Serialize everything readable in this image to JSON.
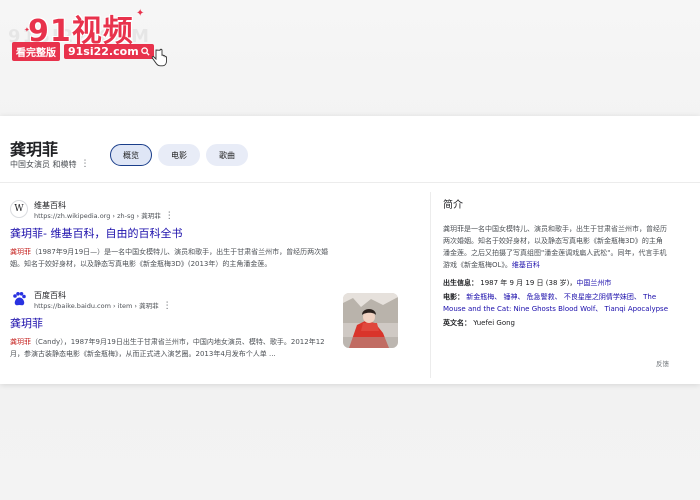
{
  "logo": {
    "brand": "91视频",
    "tag": "看完整版",
    "url": "91si22.com",
    "ghost": "91SI22.COM"
  },
  "entity": {
    "title": "龚玥菲",
    "subtitle": "中国女演员 和模特",
    "chips": [
      "概览",
      "电影",
      "歌曲"
    ]
  },
  "results": [
    {
      "source_name": "维基百科",
      "source_url": "https://zh.wikipedia.org › zh-sg › 龚玥菲",
      "title": "龚玥菲- 维基百科，自由的百科全书",
      "snippet_hl": "龚玥菲",
      "snippet": "（1987年9月19日—）是一名中国女模特儿、演员和歌手，出生于甘肃省兰州市，曾经历两次婚姻。知名于姣好身材，以及静态写真电影《新金瓶梅3D》(2013年）的主角潘金莲。"
    },
    {
      "source_name": "百度百科",
      "source_url": "https://baike.baidu.com › item › 龚玥菲",
      "title": "龚玥菲",
      "snippet_hl": "龚玥菲",
      "snippet": "（Candy），1987年9月19日出生于甘肃省兰州市，中国内地女演员、模特、歌手。2012年12月，参演古装静态电影《新金瓶梅》，从而正式进入演艺圈。2013年4月发布个人单 ..."
    }
  ],
  "knowledge_panel": {
    "title": "简介",
    "description": "龚玥菲是一名中国女模特儿、演员和歌手，出生于甘肃省兰州市，曾经历两次婚姻。知名于姣好身材，以及静态写真电影《新金瓶梅3D》的主角潘金莲。之后又拍摄了写真组图\"潘金莲调戏扁人武松\"。同年，代言手机游戏《新金瓶梅OL》。",
    "description_link": "维基百科",
    "born_label": "出生信息：",
    "born_value": "1987 年 9 月 19 日 (38 岁)，",
    "born_place": "中国兰州市",
    "films_label": "电影：",
    "films": "新金瓶梅、 锤神、 危急警救、 不良星座之阴倩学妹团、 The Mouse and the Cat: Nine Ghosts Blood Wolf、 Tianqi Apocalypse",
    "english_label": "英文名：",
    "english_value": "Yuefei Gong",
    "feedback": "反馈"
  }
}
